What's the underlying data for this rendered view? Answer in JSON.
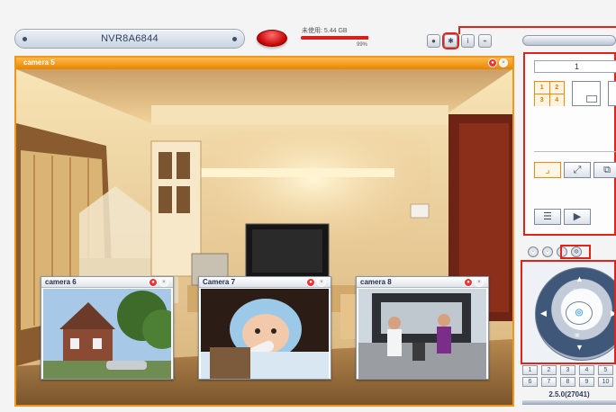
{
  "window": {
    "device_name": "NVR8A6844"
  },
  "disk": {
    "label": "未使用: 5.44 GB",
    "percent_text": "99%",
    "used_fraction": 0.99
  },
  "toolbar": {
    "icons": [
      "globe-icon",
      "gear-icon",
      "info-icon",
      "chart-icon"
    ]
  },
  "main_view": {
    "camera_label": "camera 5"
  },
  "sub_views": [
    {
      "camera_label": "camera 6"
    },
    {
      "camera_label": "Camera 7"
    },
    {
      "camera_label": "camera 8"
    }
  ],
  "layout_panel": {
    "page_value": "1",
    "grid_cells": [
      "1",
      "2",
      "3",
      "4"
    ]
  },
  "camera_buttons": [
    "1",
    "2",
    "3",
    "4",
    "5",
    "6",
    "7",
    "8",
    "9",
    "10"
  ],
  "version": "2.5.0(27041)",
  "colors": {
    "accent_orange": "#f0961a",
    "highlight_red": "#e2231a",
    "record_red": "#d40000",
    "ptz_blue": "#3f5779"
  }
}
